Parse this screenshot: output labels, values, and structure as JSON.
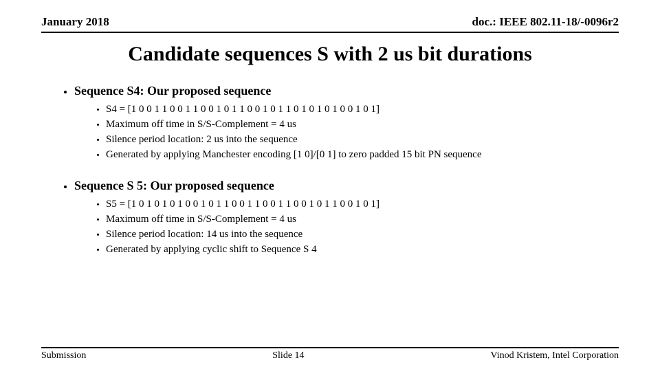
{
  "header": {
    "date": "January 2018",
    "docid": "doc.: IEEE 802.11-18/-0096r2"
  },
  "title": "Candidate sequences S with 2 us bit durations",
  "sections": {
    "s4": {
      "heading": "Sequence S4: Our proposed sequence",
      "bullets": {
        "b0": "S4 = [1 0 0 1 1 0 0 1 1 0 0 1 0 1 1 0 0 1 0 1 1 0 1 0 1 0 1 0 0 1 0 1]",
        "b1": "Maximum off time in S/S-Complement = 4 us",
        "b2": "Silence period location: 2 us into the sequence",
        "b3": "Generated by applying Manchester encoding [1 0]/[0 1] to zero padded 15 bit PN sequence"
      }
    },
    "s5": {
      "heading": "Sequence S 5: Our proposed sequence",
      "bullets": {
        "b0": "S5 = [1 0 1 0 1 0 1 0 0 1 0 1 1 0 0 1 1 0 0 1 1 0 0 1 0 1 1 0 0 1 0 1]",
        "b1": "Maximum off time in S/S-Complement = 4 us",
        "b2": "Silence period location: 14 us into the sequence",
        "b3": "Generated by applying cyclic shift to Sequence S 4"
      }
    }
  },
  "footer": {
    "left": "Submission",
    "center": "Slide 14",
    "right": "Vinod Kristem, Intel Corporation"
  }
}
